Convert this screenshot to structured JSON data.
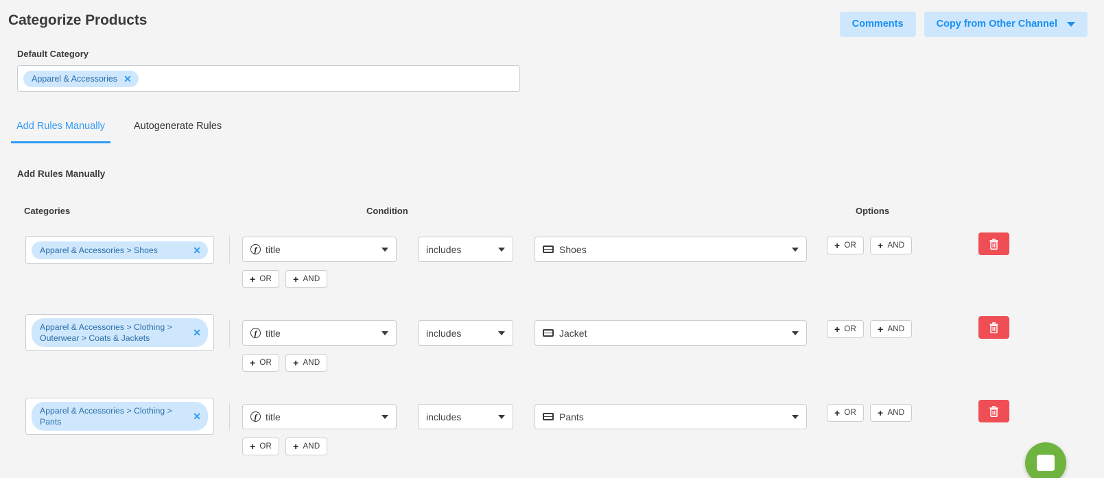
{
  "header": {
    "title": "Categorize Products",
    "comments_label": "Comments",
    "copy_label": "Copy from Other Channel"
  },
  "default_category": {
    "label": "Default Category",
    "chip": "Apparel & Accessories",
    "remove_icon": "✕"
  },
  "tabs": [
    {
      "label": "Add Rules Manually",
      "active": true
    },
    {
      "label": "Autogenerate Rules",
      "active": false
    }
  ],
  "section": {
    "title": "Add Rules Manually"
  },
  "columns": {
    "categories": "Categories",
    "condition": "Condition",
    "options": "Options"
  },
  "buttons": {
    "or": "OR",
    "and": "AND",
    "plus": "+",
    "remove_icon": "✕"
  },
  "rules": [
    {
      "category": "Apparel & Accessories > Shoes",
      "field": "title",
      "operator": "includes",
      "value": "Shoes",
      "two_line": false
    },
    {
      "category": "Apparel & Accessories > Clothing > Outerwear > Coats & Jackets",
      "field": "title",
      "operator": "includes",
      "value": "Jacket",
      "two_line": true
    },
    {
      "category": "Apparel & Accessories > Clothing > Pants",
      "field": "title",
      "operator": "includes",
      "value": "Pants",
      "two_line": true
    }
  ],
  "colors": {
    "accent_blue": "#2f9bf5",
    "chip_bg": "#cfe7fd",
    "delete_red": "#ef4e55",
    "fab_green": "#6eb43f",
    "page_bg": "#f4f4f4"
  }
}
